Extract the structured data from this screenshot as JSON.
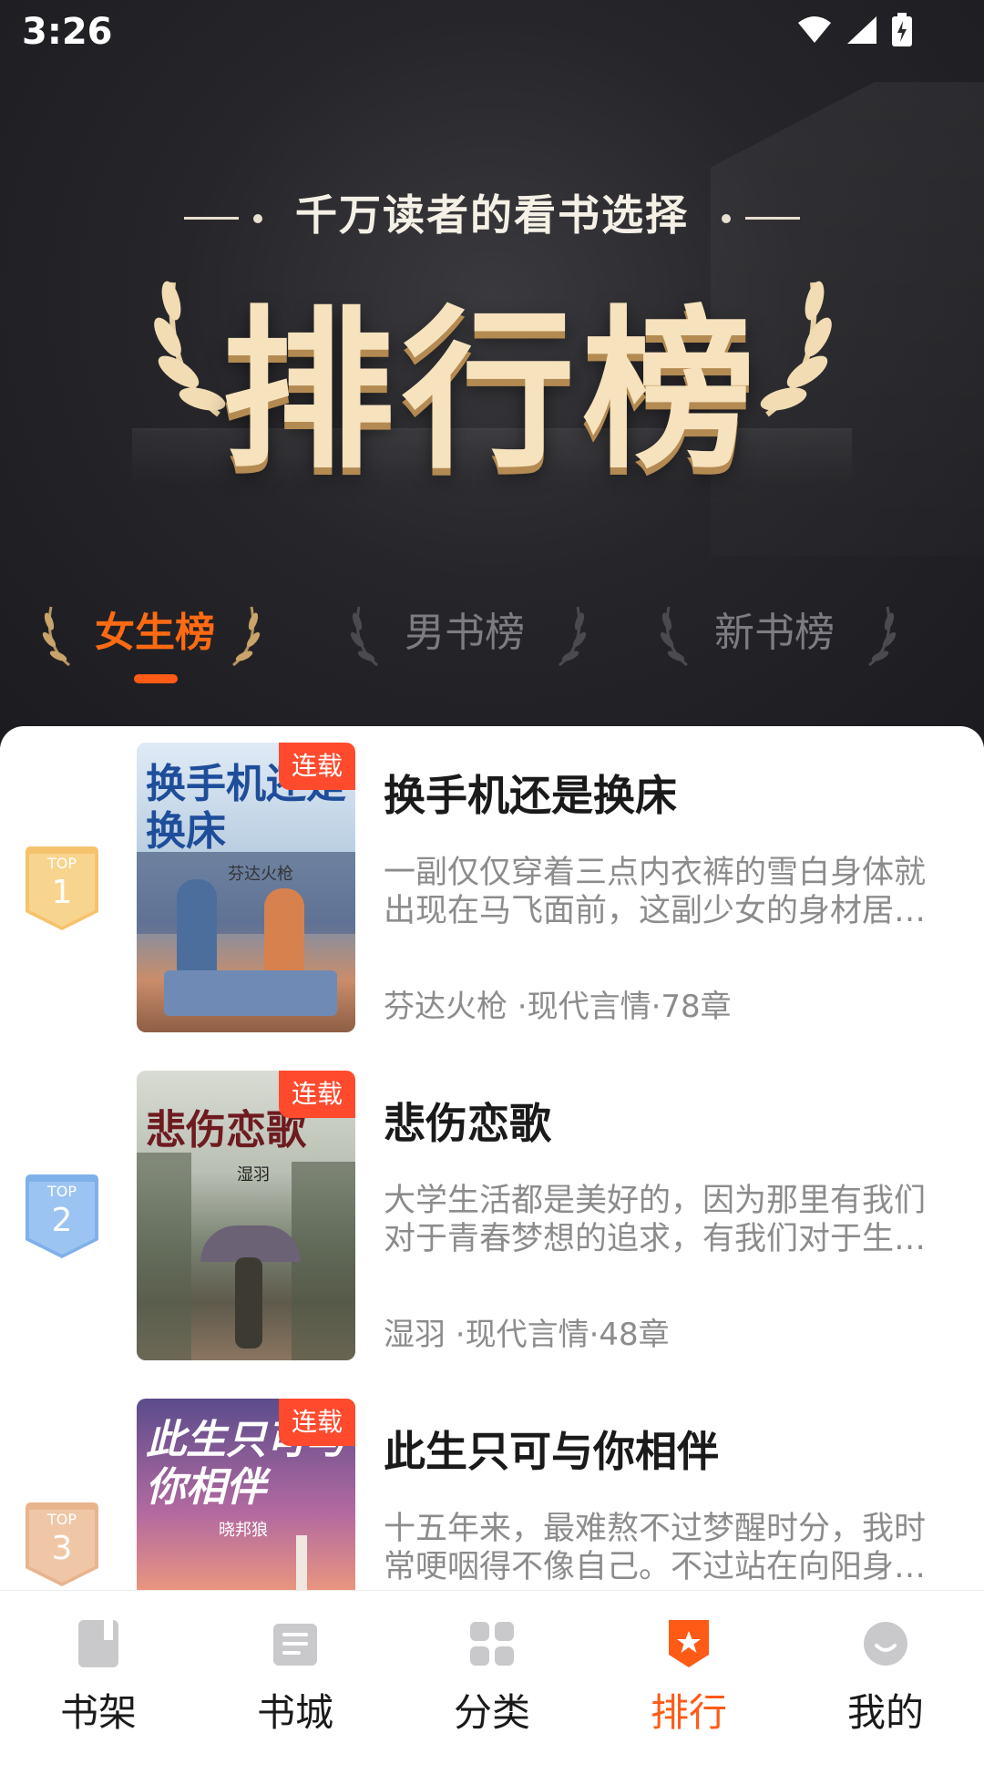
{
  "status": {
    "time": "3:26"
  },
  "hero": {
    "subtitle": "千万读者的看书选择",
    "title": "排行榜"
  },
  "tabs": [
    {
      "label": "女生榜",
      "active": true
    },
    {
      "label": "男书榜",
      "active": false
    },
    {
      "label": "新书榜",
      "active": false
    }
  ],
  "books": [
    {
      "rank": "1",
      "rank_label": "TOP",
      "title": "换手机还是换床",
      "cover_title": "换手机还是换床",
      "cover_author": "芬达火枪",
      "badge": "连载",
      "desc": "一副仅仅穿着三点内衣裤的雪白身体就出现在马飞面前，这副少女的身材居然如此完美",
      "meta": "芬达火枪 ·现代言情·78章"
    },
    {
      "rank": "2",
      "rank_label": "TOP",
      "title": "悲伤恋歌",
      "cover_title": "悲伤恋歌",
      "cover_author": "湿羽",
      "badge": "连载",
      "desc": "大学生活都是美好的，因为那里有我们对于青春梦想的追求，有我们对于生活的向往",
      "meta": "湿羽 ·现代言情·48章"
    },
    {
      "rank": "3",
      "rank_label": "TOP",
      "title": "此生只可与你相伴",
      "cover_title": "此生只可与你相伴",
      "cover_author": "晓邦狼",
      "badge": "连载",
      "desc": "十五年来，最难熬不过梦醒时分，我时常哽咽得不像自己。不过站在向阳身边的时候",
      "meta": ""
    }
  ],
  "nav": [
    {
      "label": "书架",
      "icon": "bookshelf-icon"
    },
    {
      "label": "书城",
      "icon": "bookstore-icon"
    },
    {
      "label": "分类",
      "icon": "category-icon"
    },
    {
      "label": "排行",
      "icon": "ranking-icon",
      "active": true
    },
    {
      "label": "我的",
      "icon": "profile-icon"
    }
  ],
  "colors": {
    "accent": "#ff5a16",
    "badge": "#ff4a2e",
    "gold": "#f6e2bd"
  }
}
